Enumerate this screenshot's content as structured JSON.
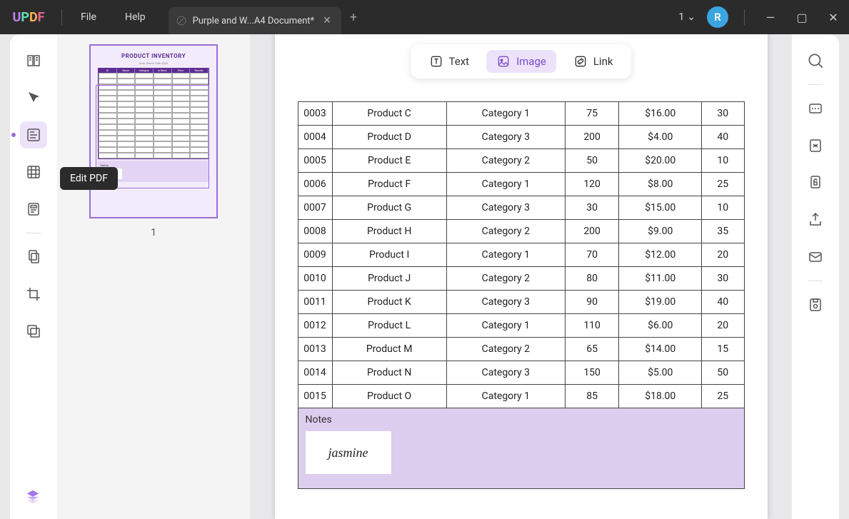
{
  "menu": {
    "file": "File",
    "help": "Help"
  },
  "tab": {
    "title": "Purple and W...A4 Document*"
  },
  "titlebar": {
    "badge": "1",
    "avatar": "R"
  },
  "tooltip": {
    "editpdf": "Edit PDF"
  },
  "thumb": {
    "title": "PRODUCT INVENTORY",
    "date": "Date: March 26th 2023",
    "notes": "Notes",
    "num": "1"
  },
  "editor_tools": {
    "text": "Text",
    "image": "Image",
    "link": "Link"
  },
  "table": {
    "rows": [
      {
        "id": "0003",
        "name": "Product C",
        "cat": "Category 1",
        "qty": "75",
        "price": "$16.00",
        "reorder": "30"
      },
      {
        "id": "0004",
        "name": "Product D",
        "cat": "Category 3",
        "qty": "200",
        "price": "$4.00",
        "reorder": "40"
      },
      {
        "id": "0005",
        "name": "Product E",
        "cat": "Category 2",
        "qty": "50",
        "price": "$20.00",
        "reorder": "10"
      },
      {
        "id": "0006",
        "name": "Product F",
        "cat": "Category 1",
        "qty": "120",
        "price": "$8.00",
        "reorder": "25"
      },
      {
        "id": "0007",
        "name": "Product G",
        "cat": "Category 3",
        "qty": "30",
        "price": "$15.00",
        "reorder": "10"
      },
      {
        "id": "0008",
        "name": "Product H",
        "cat": "Category 2",
        "qty": "200",
        "price": "$9.00",
        "reorder": "35"
      },
      {
        "id": "0009",
        "name": "Product I",
        "cat": "Category 1",
        "qty": "70",
        "price": "$12.00",
        "reorder": "20"
      },
      {
        "id": "0010",
        "name": "Product J",
        "cat": "Category 2",
        "qty": "80",
        "price": "$11.00",
        "reorder": "30"
      },
      {
        "id": "0011",
        "name": "Product K",
        "cat": "Category 3",
        "qty": "90",
        "price": "$19.00",
        "reorder": "40"
      },
      {
        "id": "0012",
        "name": "Product L",
        "cat": "Category 1",
        "qty": "110",
        "price": "$6.00",
        "reorder": "20"
      },
      {
        "id": "0013",
        "name": "Product M",
        "cat": "Category 2",
        "qty": "65",
        "price": "$14.00",
        "reorder": "15"
      },
      {
        "id": "0014",
        "name": "Product N",
        "cat": "Category 3",
        "qty": "150",
        "price": "$5.00",
        "reorder": "50"
      },
      {
        "id": "0015",
        "name": "Product O",
        "cat": "Category 1",
        "qty": "85",
        "price": "$18.00",
        "reorder": "25"
      }
    ]
  },
  "notes": {
    "label": "Notes",
    "signature": "jasmine"
  }
}
